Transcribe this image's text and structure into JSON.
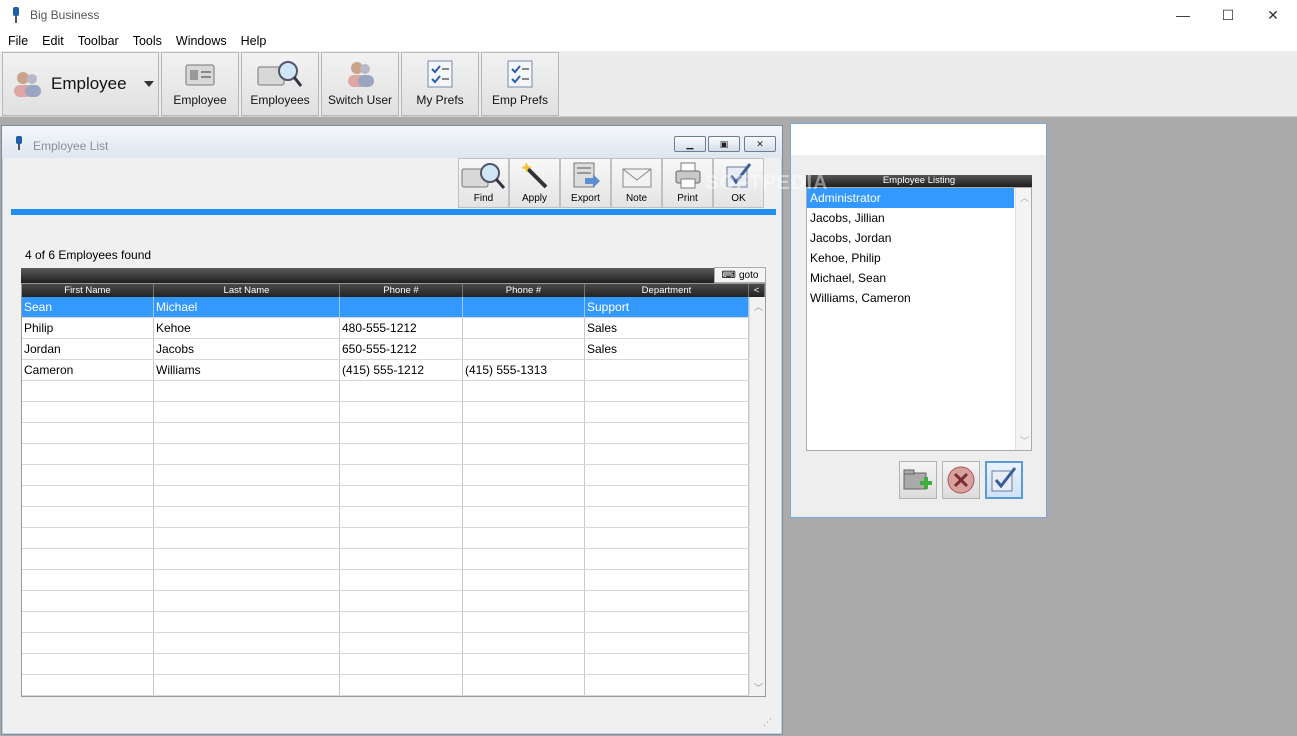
{
  "app": {
    "title": "Big Business"
  },
  "window_controls": {
    "minimize": "—",
    "maximize": "☐",
    "close": "✕"
  },
  "menu": [
    "File",
    "Edit",
    "Toolbar",
    "Tools",
    "Windows",
    "Help"
  ],
  "toolbar": {
    "module_label": "Employee",
    "buttons": [
      "Employee",
      "Employees",
      "Switch User",
      "My Prefs",
      "Emp Prefs"
    ]
  },
  "employee_list": {
    "title": "Employee List",
    "actions": [
      "Find",
      "Apply",
      "Export",
      "Note",
      "Print",
      "OK"
    ],
    "found_text": "4 of 6 Employees found",
    "goto_label": "goto",
    "columns": [
      "First Name",
      "Last Name",
      "Phone #",
      "Phone #",
      "Department",
      "<"
    ],
    "rows": [
      [
        "Sean",
        "Michael",
        "",
        "",
        "Support"
      ],
      [
        "Philip",
        "Kehoe",
        "480-555-1212",
        "",
        "Sales"
      ],
      [
        "Jordan",
        "Jacobs",
        "650-555-1212",
        "",
        "Sales"
      ],
      [
        "Cameron",
        "Williams",
        "(415) 555-1212",
        "(415) 555-1313",
        ""
      ]
    ],
    "selected_row": 0
  },
  "employee_listing": {
    "header": "Employee Listing",
    "items": [
      "Administrator",
      "Jacobs, Jillian",
      "Jacobs, Jordan",
      "Kehoe, Philip",
      "Michael, Sean",
      "Williams, Cameron"
    ],
    "selected_index": 0
  },
  "watermark": "SOFTPEDIA",
  "colors": {
    "selection": "#3399ff",
    "accent_bar": "#1e8ff0",
    "desktop": "#ababab"
  }
}
